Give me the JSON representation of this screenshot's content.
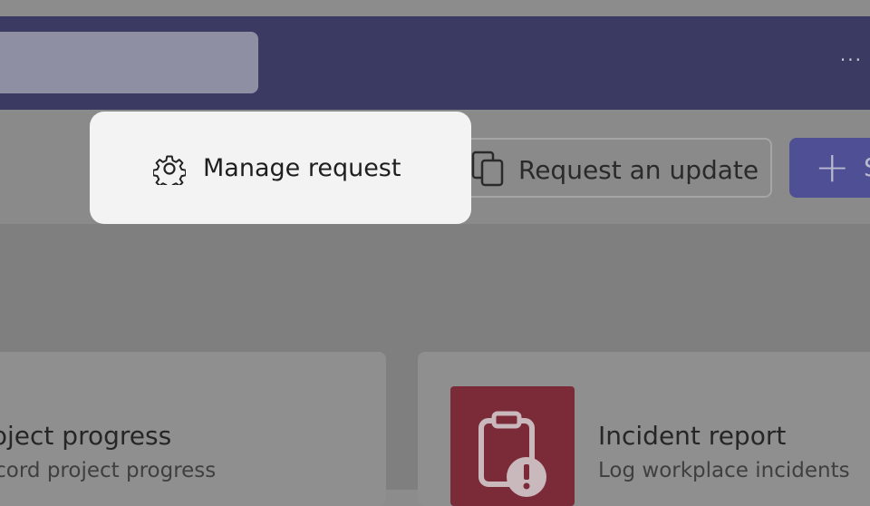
{
  "header": {
    "more_label": "···"
  },
  "popover": {
    "manage_label": "Manage request",
    "icon": "gear-icon"
  },
  "toolbar": {
    "request_update_label": "Request an update",
    "request_update_icon": "devices-icon",
    "primary_icon": "plus-icon",
    "primary_label": "S"
  },
  "cards": [
    {
      "title": "roject progress",
      "description": "ecord project progress"
    },
    {
      "title": "Incident report",
      "description": "Log workplace incidents",
      "icon": "clipboard-alert-icon",
      "tile_color": "#7b2a38"
    }
  ],
  "colors": {
    "header": "#3a3a62",
    "primary": "#4f4f95",
    "popover": "#f3f3f3",
    "overlay": "#8c8c8c"
  }
}
